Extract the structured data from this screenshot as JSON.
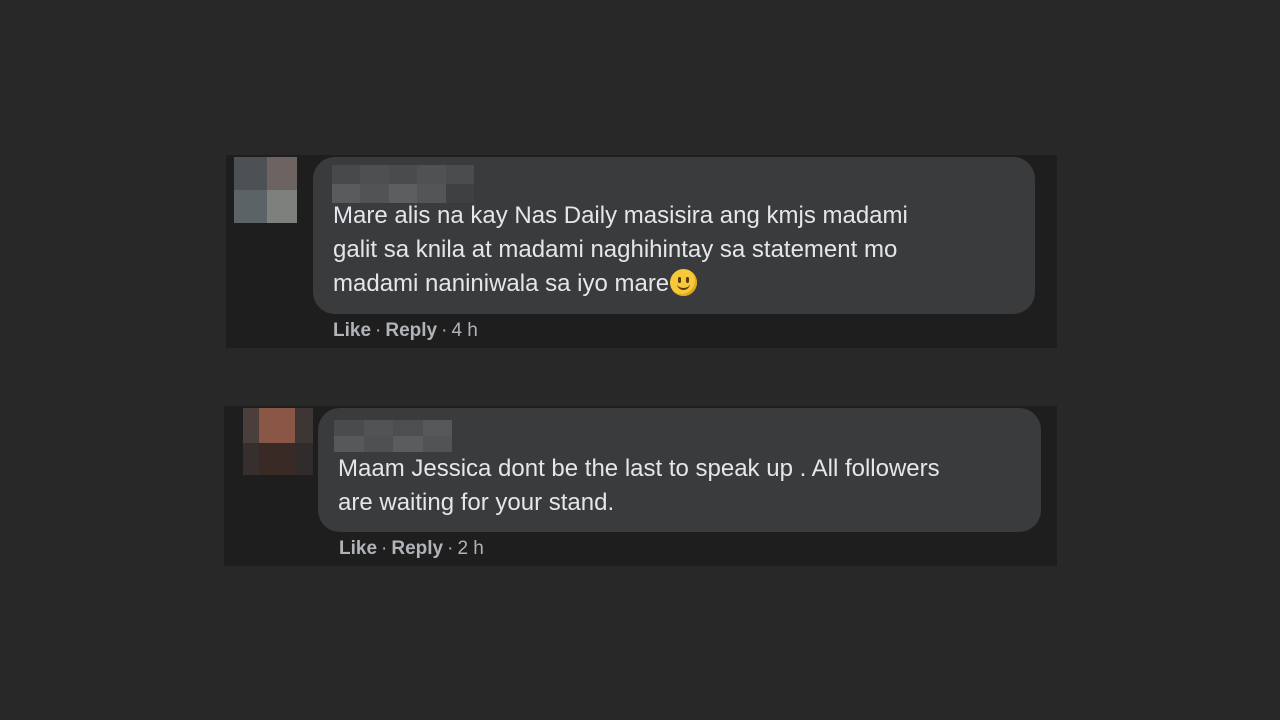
{
  "comments": [
    {
      "text": "Mare alis na kay Nas Daily masisira ang kmjs madami\ngalit sa knila at madami naghihintay sa statement mo\nmadami naniniwala sa iyo mare",
      "emoji": "slightly-smiling-face",
      "like_label": "Like",
      "reply_label": "Reply",
      "time": "4 h"
    },
    {
      "text": "Maam Jessica dont be the last to speak up . All followers\nare waiting for your stand.",
      "like_label": "Like",
      "reply_label": "Reply",
      "time": "2 h"
    }
  ],
  "colors": {
    "background": "#282828",
    "card": "#1e1e1f",
    "bubble": "#3a3b3c",
    "text": "#e4e6eb",
    "meta": "#b0b3b8"
  }
}
